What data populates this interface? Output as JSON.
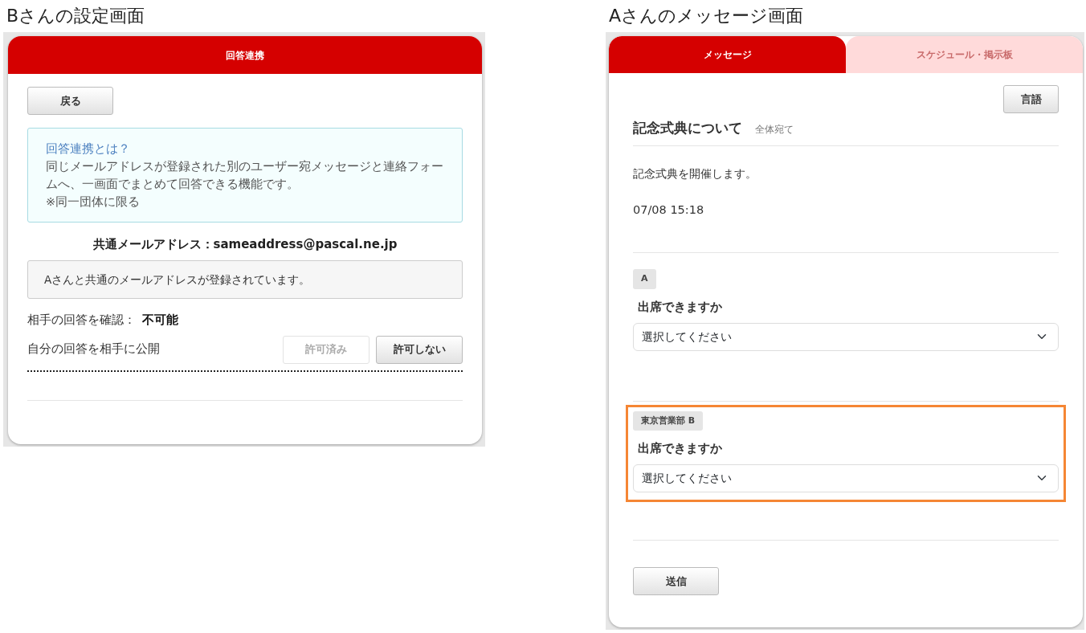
{
  "settings_screen": {
    "caption": "Bさんの設定画面",
    "header": "回答連携",
    "back_button": "戻る",
    "info_box": {
      "title": "回答連携とは？",
      "text": "同じメールアドレスが登録された別のユーザー宛メッセージと連絡フォームへ、一画面でまとめて回答できる機能です。",
      "note": "※同一団体に限る"
    },
    "common_address": "共通メールアドレス：sameaddress@pascal.ne.jp",
    "notice": "Aさんと共通のメールアドレスが登録されています。",
    "confirm": {
      "label": "相手の回答を確認：",
      "value": "不可能"
    },
    "publish": {
      "label": "自分の回答を相手に公開",
      "buttons": [
        {
          "label": "許可済み",
          "disabled": true
        },
        {
          "label": "許可しない",
          "disabled": false
        }
      ]
    }
  },
  "message_screen": {
    "caption": "Aさんのメッセージ画面",
    "tabs": [
      {
        "label": "メッセージ",
        "selected": true
      },
      {
        "label": "スケジュール・掲示板",
        "selected": false
      }
    ],
    "language_button": "言語",
    "title": "記念式典について",
    "recipient": "全体宛て",
    "body": "記念式典を開催します。",
    "datetime": "07/08 15:18",
    "questions": [
      {
        "tag": "A",
        "question": "出席できますか",
        "select_value": "選択してください",
        "highlighted": false
      },
      {
        "tag": "東京営業部 B",
        "question": "出席できますか",
        "select_value": "選択してください",
        "highlighted": true
      }
    ],
    "submit_button": "送信"
  }
}
